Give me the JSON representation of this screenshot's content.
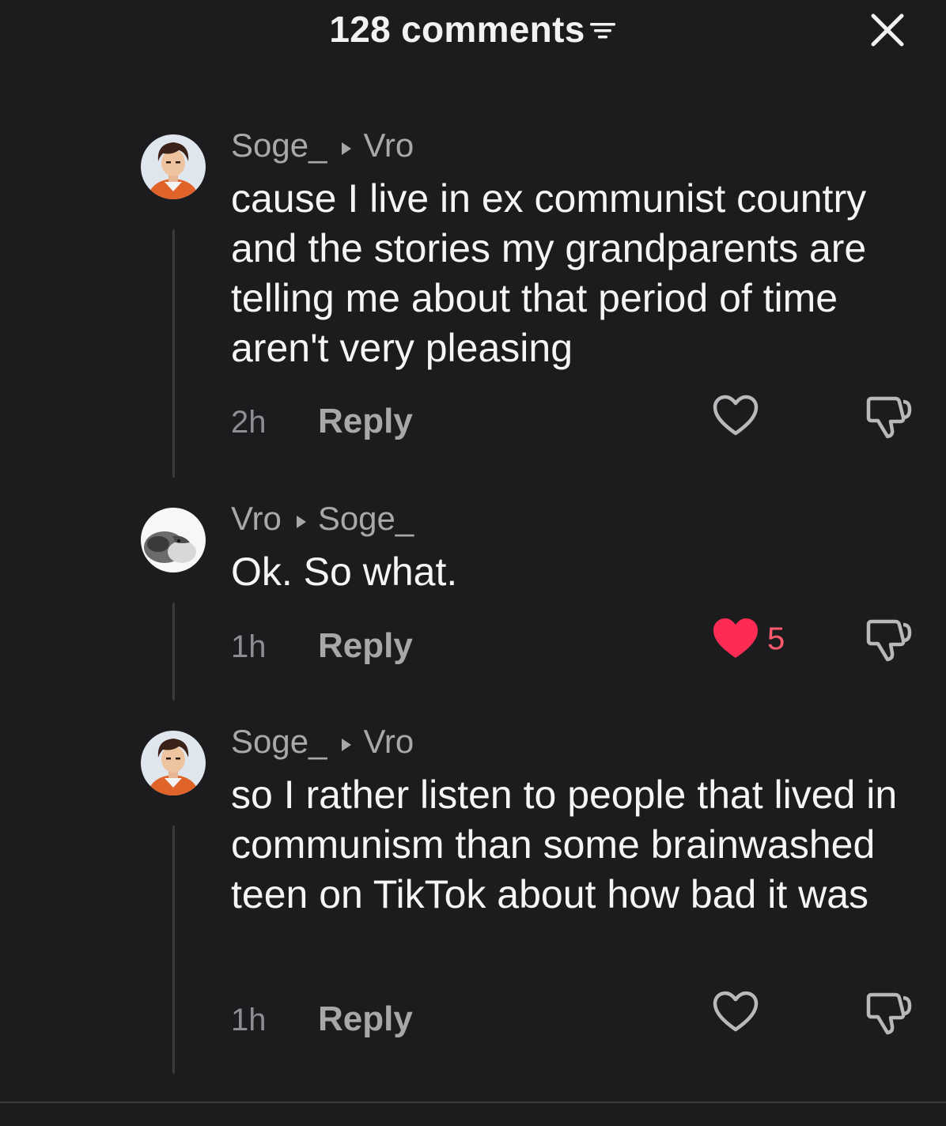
{
  "header": {
    "title": "128 comments",
    "sort_icon": "sort-lines-icon",
    "close_icon": "close-x-icon"
  },
  "colors": {
    "background": "#1c1c1e",
    "liked_heart": "#fe2c55",
    "muted_text": "#a8a8ab"
  },
  "comments": [
    {
      "author": "Soge_",
      "reply_to": "Vro",
      "text": "cause I live in ex communist country and the stories my grandparents are telling me about that period of time aren't very pleasing",
      "time": "2h",
      "reply_label": "Reply",
      "liked": false,
      "like_count": ""
    },
    {
      "author": "Vro",
      "reply_to": "Soge_",
      "text": "Ok. So what.",
      "time": "1h",
      "reply_label": "Reply",
      "liked": true,
      "like_count": "5"
    },
    {
      "author": "Soge_",
      "reply_to": "Vro",
      "text": "so I rather listen to people that lived in communism than some brainwashed teen on TikTok about how bad it was",
      "time": "1h",
      "reply_label": "Reply",
      "liked": false,
      "like_count": ""
    }
  ]
}
